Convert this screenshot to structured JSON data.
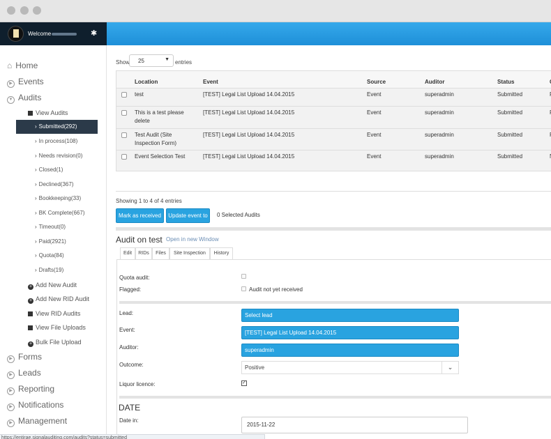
{
  "header": {
    "welcome": "Welcome"
  },
  "sidebar": {
    "home": "Home",
    "events": "Events",
    "audits": "Audits",
    "view_audits": "View Audits",
    "statuses": [
      "Submitted(292)",
      "In process(108)",
      "Needs revision(0)",
      "Closed(1)",
      "Declined(367)",
      "Bookkeeping(33)",
      "BK Complete(667)",
      "Timeout(0)",
      "Paid(2921)",
      "Quota(84)",
      "Drafts(19)"
    ],
    "add_new_audit": "Add New Audit",
    "add_new_rid_audit": "Add New RID Audit",
    "view_rid_audits": "View RID Audits",
    "view_file_uploads": "View File Uploads",
    "bulk_file_upload": "Bulk File Upload",
    "forms": "Forms",
    "leads": "Leads",
    "reporting": "Reporting",
    "notifications": "Notifications",
    "management": "Management"
  },
  "table_controls": {
    "show": "Show",
    "page_size": "25",
    "entries": "entries"
  },
  "table": {
    "columns": [
      "Location",
      "Event",
      "Source",
      "Auditor",
      "Status",
      "C"
    ],
    "rows": [
      {
        "location": "test",
        "event": "[TEST] Legal List Upload 14.04.2015",
        "source": "Event",
        "auditor": "superadmin",
        "status": "Submitted",
        "extra": "F"
      },
      {
        "location": "This is a test please delete",
        "event": "[TEST] Legal List Upload 14.04.2015",
        "source": "Event",
        "auditor": "superadmin",
        "status": "Submitted",
        "extra": "F"
      },
      {
        "location": "Test Audit (Site Inspection Form)",
        "event": "[TEST] Legal List Upload 14.04.2015",
        "source": "Event",
        "auditor": "superadmin",
        "status": "Submitted",
        "extra": "F"
      },
      {
        "location": "Event Selection Test",
        "event": "[TEST] Legal List Upload 14.04.2015",
        "source": "Event",
        "auditor": "superadmin",
        "status": "Submitted",
        "extra": "N"
      }
    ]
  },
  "showing": "Showing 1 to 4 of 4 entries",
  "actions": {
    "mark_received": "Mark as received",
    "update_event": "Update event to",
    "selected_count": "0 Selected Audits"
  },
  "audit": {
    "title": "Audit on test",
    "open_new_window": "Open in new Window",
    "tabs": [
      "Edit",
      "RIDs",
      "Files",
      "Site Inspection",
      "History"
    ],
    "quota_label": "Quota audit:",
    "flagged_label": "Flagged:",
    "not_received": "Audit not yet received",
    "lead_label": "Lead:",
    "lead_value": "Select lead",
    "event_label": "Event:",
    "event_value": "[TEST] Legal List Upload 14.04.2015",
    "auditor_label": "Auditor:",
    "auditor_value": "superadmin",
    "outcome_label": "Outcome:",
    "outcome_value": "Positive",
    "liquor_label": "Liquor licence:",
    "date_title": "DATE",
    "date_in_label": "Date in:",
    "date_in_value": "2015-11-22"
  },
  "statusbar": {
    "url": "https://entirae.signalauditing.com/audits?status=submitted"
  }
}
